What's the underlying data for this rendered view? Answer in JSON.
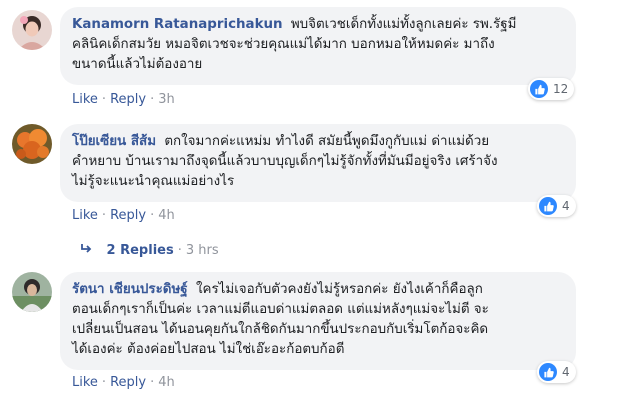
{
  "comments": [
    {
      "author": "Kanamorn Ratanaprichakun",
      "text": "พบจิตเวชเด็กทั้งแม่ทั้งลูกเลยค่ะ รพ.รัฐมี\nคลินิคเด็กสมวัย หมอจิตเวชจะช่วยคุณแม่ได้มาก บอกหมอให้หมดค่ะ มาถึง\nขนาดนี้แล้วไม่ต้องอาย",
      "like_label": "Like",
      "reply_label": "Reply",
      "time": "3h",
      "reaction_count": "12",
      "reaction_icon": "like-icon",
      "avatar_color": "#d9a7a0"
    },
    {
      "author": "โป๊ยเซียน สีส้ม",
      "text": "ตกใจมากค่ะแหม่ม ทำไงดี สมัยนี้พูดมึงกูกับแม่ ด่าแม่ด้วย\nคำหยาบ บ้านเรามาถึงจุดนี้แล้วบาบบุญเด็กๆไม่รู้จักทั้งที่มันมีอยู่จริง เศร้าจัง\nไม่รู้จะแนะนำคุณแม่อย่างไร",
      "like_label": "Like",
      "reply_label": "Reply",
      "time": "4h",
      "reaction_count": "4",
      "reaction_icon": "like-icon",
      "avatar_color": "#e0702a"
    },
    {
      "author": "รัตนา เชียนประดิษฐ์",
      "text": "ใครไม่เจอกับตัวคงยังไม่รู้หรอกค่ะ ยังไงเค้าก็คือลูก\nตอนเด็กๆเราก็เป็นค่ะ เวลาแม่ตีแอบด่าแม่ตลอด แต่แม่หลังๆแม่จะไม่ตี จะ\nเปลี่ยนเป็นสอน ได้นอนคุยกันใกล้ชิดกันมากขึ้นประกอบกับเริ่มโตก้อจะคิด\nได้เองค่ะ ต้องค่อยไปสอน ไม่ใช่เอ๊ะอะก้อตบก้อตี",
      "like_label": "Like",
      "reply_label": "Reply",
      "time": "4h",
      "reaction_count": "4",
      "reaction_icon": "like-icon",
      "avatar_color": "#8a9c7a"
    }
  ],
  "replies_link": {
    "icon": "reply-arrow-icon",
    "label": "2 Replies",
    "time": "3 hrs"
  },
  "colors": {
    "bubble_bg": "#f2f3f5",
    "link_blue": "#385898",
    "like_blue": "#2d88ff",
    "meta_gray": "#90949c"
  }
}
